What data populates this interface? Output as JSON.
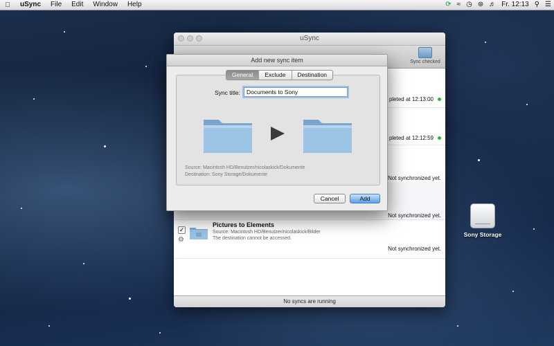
{
  "menubar": {
    "app": "uSync",
    "items": [
      "File",
      "Edit",
      "Window",
      "Help"
    ],
    "clock": "Fr. 12:13"
  },
  "main_window": {
    "title": "uSync",
    "toolbar": {
      "sync_checked_label": "Sync checked"
    },
    "rows": [
      {
        "status": "pleted at 12:13:00",
        "ok": true
      },
      {
        "status": "pleted at 12:12:59",
        "ok": true
      },
      {
        "status": "Not synchronized yet.",
        "ok": false
      },
      {
        "status": "Not synchronized yet.",
        "ok": false
      },
      {
        "title": "Pictures to Elements",
        "source": "Source: Macintosh HD/Benutzer/nicolaskick/Bilder",
        "note": "The destination cannot be accessed.",
        "status": "Not synchronized yet.",
        "checked": true
      }
    ],
    "footer": "No syncs are running"
  },
  "dialog": {
    "title": "Add new sync item",
    "tabs": [
      {
        "label": "General",
        "selected": true
      },
      {
        "label": "Exclude",
        "selected": false
      },
      {
        "label": "Destination",
        "selected": false
      }
    ],
    "sync_title_label": "Sync title:",
    "sync_title_value": "Documents to Sony",
    "source": "Source: Macintosh HD/Benutzer/nicolaskick/Dokumente",
    "destination": "Destination: Sony Storage/Dokumente",
    "cancel_label": "Cancel",
    "add_label": "Add"
  },
  "desktop": {
    "drive_label": "Sony Storage"
  },
  "colors": {
    "accent": "#5aa0e6",
    "ok_dot": "#31b535",
    "folder": "#8db8dc"
  }
}
